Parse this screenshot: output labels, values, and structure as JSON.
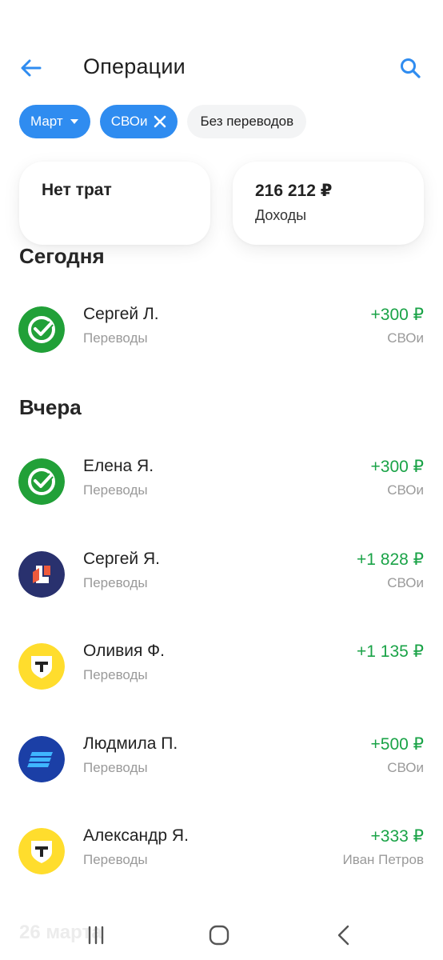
{
  "header": {
    "title": "Операции"
  },
  "filters": {
    "month": "Март",
    "account": "СВОи",
    "transfers": "Без переводов"
  },
  "summary": {
    "spend": "Нет трат",
    "income_value": "216 212 ₽",
    "income_label": "Доходы"
  },
  "sections": {
    "today": "Сегодня",
    "yesterday": "Вчера",
    "next_date": "26 марта"
  },
  "colors": {
    "accent": "#2f8cf0",
    "income": "#1aa347",
    "sber": "#21a038",
    "tbank": "#ffdd2d",
    "bank_navy": "#29316e",
    "bank_blue": "#1b3fa6"
  },
  "today_operations": [
    {
      "name": "Сергей Л.",
      "category": "Переводы",
      "amount": "+300 ₽",
      "tag": "СВОи",
      "icon": "sber-bank-icon"
    }
  ],
  "yesterday_operations": [
    {
      "name": "Елена Я.",
      "category": "Переводы",
      "amount": "+300 ₽",
      "tag": "СВОи",
      "icon": "sber-bank-icon"
    },
    {
      "name": "Сергей Я.",
      "category": "Переводы",
      "amount": "+1 828 ₽",
      "tag": "СВОи",
      "icon": "navy-bank-logo-icon"
    },
    {
      "name": "Оливия Ф.",
      "category": "Переводы",
      "amount": "+1 135 ₽",
      "tag": "",
      "icon": "t-bank-icon"
    },
    {
      "name": "Людмила П.",
      "category": "Переводы",
      "amount": "+500 ₽",
      "tag": "СВОи",
      "icon": "blue-bank-logo-icon"
    },
    {
      "name": "Александр Я.",
      "category": "Переводы",
      "amount": "+333 ₽",
      "tag": "Иван Петров",
      "icon": "t-bank-icon"
    }
  ]
}
